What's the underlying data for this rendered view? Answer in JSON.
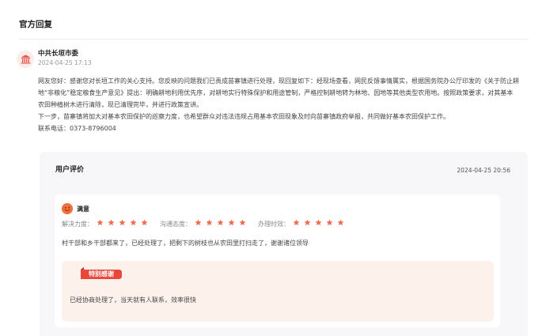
{
  "section": {
    "title": "官方回复"
  },
  "reply": {
    "org_name": "中共长垣市委",
    "time": "2024-04-25 17:13",
    "lines": [
      "网友您好：感谢您对长垣工作的关心支持。您反映的问题我们已责成苗寨镇进行处理，现回复如下：经现场查看，网民反馈事情属实，根据国务院办公厅印发的《关于防止耕",
      "地“非粮化”稳定粮食生产意见》提出：明确耕地利用优先序，对耕地实行特殊保护和用途管制，严格控制耕地转为林地、园地等其他类型农用地。按照政策要求，对其基本",
      "农田种植树木进行清除，现已清理完毕，并进行政策宣讲。",
      "下一步，苗寨镇将加大对基本农田保护的巡察力度，也希望群众对违法违规占用基本农田现象及时向苗寨镇政府举报，共同做好基本农田保护工作。",
      "联系电话：0373-8796004"
    ]
  },
  "evaluation": {
    "title": "用户评价",
    "time": "2024-04-25 20:56",
    "mood": "满意",
    "ratings": [
      {
        "label": "解决力度：",
        "stars": 5
      },
      {
        "label": "沟通态度：",
        "stars": 5
      },
      {
        "label": "办理时效：",
        "stars": 5
      }
    ],
    "comment": "村干部和乡干部都来了，已经处理了，把剩下的树枝也从农田里打扫走了，谢谢诸位领导",
    "thanks_badge": "特别感谢",
    "thanks_text": "已经协商处理了，当天就有人联系，效率很快",
    "star_color": "#f26d4f",
    "accent": "#e9473b"
  }
}
